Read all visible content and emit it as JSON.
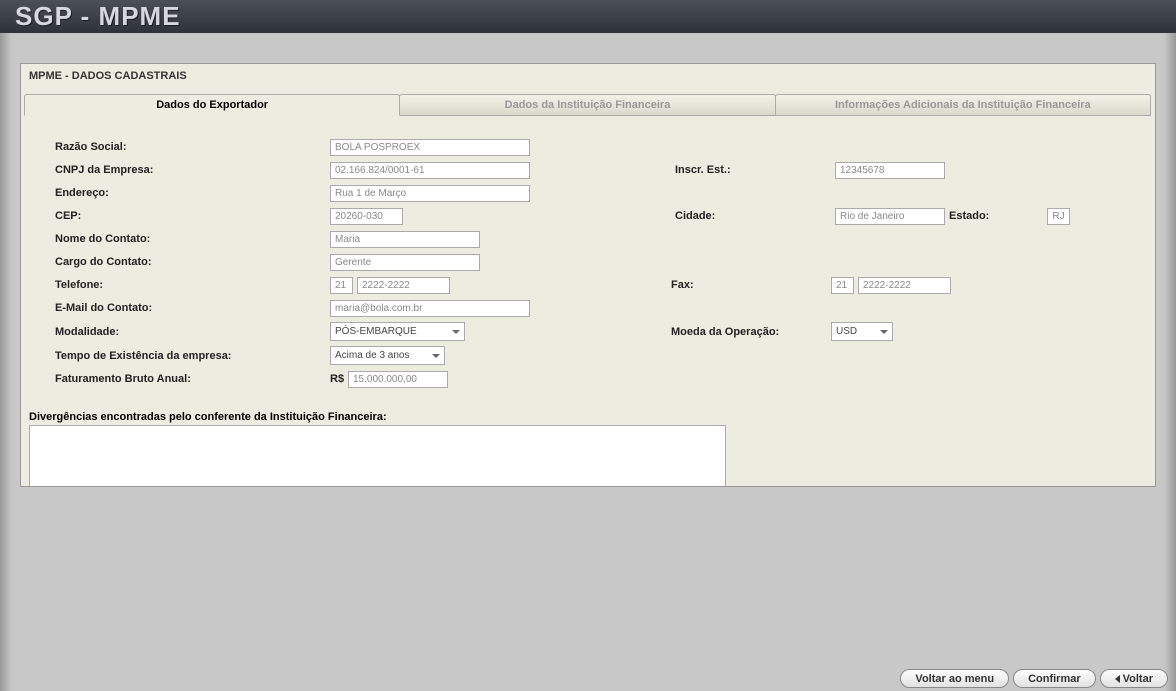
{
  "app": {
    "title": "SGP - MPME"
  },
  "section": {
    "title": "MPME - DADOS CADASTRAIS"
  },
  "tabs": {
    "t0": "Dados do Exportador",
    "t1": "Dados da Instituição Financeira",
    "t2": "Informações Adicionais da Instituição Financeira"
  },
  "labels": {
    "razao_social": "Razão Social:",
    "cnpj": "CNPJ da Empresa:",
    "inscr_est": "Inscr. Est.:",
    "endereco": "Endereço:",
    "cep": "CEP:",
    "cidade": "Cidade:",
    "estado": "Estado:",
    "nome_contato": "Nome do Contato:",
    "cargo_contato": "Cargo do Contato:",
    "telefone": "Telefone:",
    "fax": "Fax:",
    "email_contato": "E-Mail do Contato:",
    "modalidade": "Modalidade:",
    "moeda": "Moeda da Operação:",
    "tempo_exist": "Tempo de Existência da empresa:",
    "fat_bruto": "Faturamento Bruto Anual:",
    "rs": "R$",
    "divergencias": "Divergências encontradas pelo conferente da Instituição Financeira:"
  },
  "values": {
    "razao_social": "BOLA POSPROEX",
    "cnpj": "02.166.824/0001-61",
    "inscr_est": "12345678",
    "endereco": "Rua 1 de Março",
    "cep": "20260-030",
    "cidade": "Rio de Janeiro",
    "estado": "RJ",
    "nome_contato": "Maria",
    "cargo_contato": "Gerente",
    "tel_ddd": "21",
    "tel_num": "2222-2222",
    "fax_ddd": "21",
    "fax_num": "2222-2222",
    "email": "maria@bola.com.br",
    "modalidade": "PÓS-EMBARQUE",
    "moeda": "USD",
    "tempo_exist": "Acima de 3 anos",
    "fat_bruto": "15.000.000,00",
    "divergencias": ""
  },
  "buttons": {
    "voltar_menu": "Voltar ao menu",
    "confirmar": "Confirmar",
    "voltar": "Voltar"
  }
}
